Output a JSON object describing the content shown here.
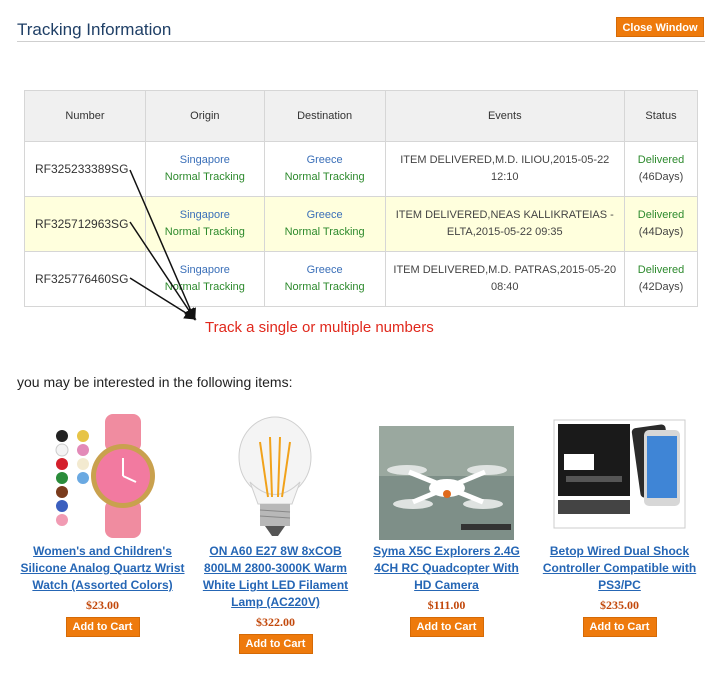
{
  "header": {
    "title": "Tracking Information",
    "close_label": "Close Window"
  },
  "table": {
    "headers": [
      "Number",
      "Origin",
      "Destination",
      "Events",
      "Status"
    ],
    "rows": [
      {
        "number": "RF325233389SG",
        "origin": "Singapore",
        "origin_tracking": "Normal Tracking",
        "destination": "Greece",
        "destination_tracking": "Normal Tracking",
        "event": "ITEM DELIVERED,M.D. ILIOU,2015-05-22 12:10",
        "status": "Delivered",
        "days": "(46Days)"
      },
      {
        "number": "RF325712963SG",
        "origin": "Singapore",
        "origin_tracking": "Normal Tracking",
        "destination": "Greece",
        "destination_tracking": "Normal Tracking",
        "event": "ITEM DELIVERED,NEAS KALLIKRATEIAS - ELTA,2015-05-22 09:35",
        "status": "Delivered",
        "days": "(44Days)"
      },
      {
        "number": "RF325776460SG",
        "origin": "Singapore",
        "origin_tracking": "Normal Tracking",
        "destination": "Greece",
        "destination_tracking": "Normal Tracking",
        "event": "ITEM DELIVERED,M.D. PATRAS,2015-05-20 08:40",
        "status": "Delivered",
        "days": "(42Days)"
      }
    ]
  },
  "callout": "Track a single or multiple numbers",
  "recommend": {
    "heading": "you may be interested in the following items:",
    "cart_label": "Add to Cart",
    "products": [
      {
        "name": "Women's and Children's Silicone Analog Quartz Wrist Watch (Assorted Colors)",
        "price": "$23.00"
      },
      {
        "name": "ON A60 E27 8W 8xCOB 800LM 2800-3000K Warm White Light LED Filament Lamp (AC220V)",
        "price": "$322.00"
      },
      {
        "name": "Syma X5C Explorers 2.4G 4CH RC Quadcopter With HD Camera",
        "price": "$111.00"
      },
      {
        "name": "Betop Wired Dual Shock Controller Compatible with PS3/PC",
        "price": "$235.00"
      }
    ]
  },
  "colors": {
    "accent": "#ee7a0c",
    "title": "#1f3f66",
    "link": "#2566b5",
    "status": "#2d8a2d",
    "callout": "#e0281c",
    "highlight_row": "#ffffdd"
  }
}
